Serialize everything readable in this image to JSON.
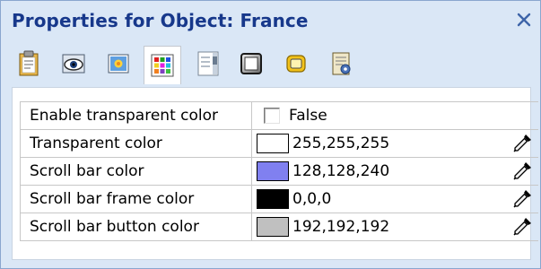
{
  "window": {
    "title": "Properties for Object: France",
    "close_glyph": "×"
  },
  "toolbar": {
    "icons": [
      {
        "name": "clipboard-icon",
        "active": false
      },
      {
        "name": "eye-icon",
        "active": false
      },
      {
        "name": "image-icon",
        "active": false
      },
      {
        "name": "color-grid-icon",
        "active": true
      },
      {
        "name": "scrollbar-icon",
        "active": false
      },
      {
        "name": "frame-icon",
        "active": false
      },
      {
        "name": "button-icon",
        "active": false
      },
      {
        "name": "settings-sheet-icon",
        "active": false
      }
    ]
  },
  "properties": {
    "rows": [
      {
        "label": "Enable transparent color",
        "type": "checkbox",
        "checked": false,
        "value": "False"
      },
      {
        "label": "Transparent color",
        "type": "color",
        "swatch": "#ffffff",
        "value": "255,255,255"
      },
      {
        "label": "Scroll bar color",
        "type": "color",
        "swatch": "#8080f0",
        "value": "128,128,240"
      },
      {
        "label": "Scroll bar frame color",
        "type": "color",
        "swatch": "#000000",
        "value": "0,0,0"
      },
      {
        "label": "Scroll bar button color",
        "type": "color",
        "swatch": "#c0c0c0",
        "value": "192,192,192"
      }
    ]
  },
  "colors": {
    "panel_background": "#dae7f6",
    "title_color": "#17388b",
    "grid_line": "#c7c7c7"
  }
}
